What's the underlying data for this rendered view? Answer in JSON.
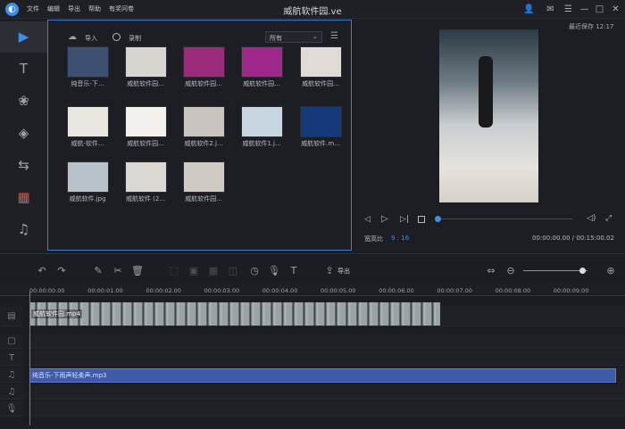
{
  "app": {
    "title": "威航软件园.ve",
    "menu": [
      "文件",
      "编辑",
      "导出",
      "帮助",
      "有奖问卷"
    ],
    "autosave": "最近保存 12:17"
  },
  "media_toolbar": {
    "import_label": "导入",
    "record_label": "录制",
    "filter_value": "所有"
  },
  "media_items": [
    {
      "label": "纯音乐-下..."
    },
    {
      "label": "威航软件园..."
    },
    {
      "label": "威航软件园..."
    },
    {
      "label": "威航软件园..."
    },
    {
      "label": "威航软件园..."
    },
    {
      "label": "威航-软件..."
    },
    {
      "label": "威航软件园..."
    },
    {
      "label": "威航软件2.j..."
    },
    {
      "label": "威航软件1.j..."
    },
    {
      "label": "威航软件.m..."
    },
    {
      "label": "威航软件.jpg"
    },
    {
      "label": "威航软件 (2..."
    },
    {
      "label": "威航软件园..."
    }
  ],
  "preview": {
    "aspect_label": "宽高比",
    "aspect_value": "9 : 16",
    "time": "00:00:00.00 / 00:15:00.02"
  },
  "timeline_toolbar": {
    "export_label": "导出"
  },
  "ruler": [
    "00:00:00.00",
    "00:00:01.00",
    "00:00:02.00",
    "00:00:03.00",
    "00:00:04.00",
    "00:00:05.00",
    "00:00:06.00",
    "00:00:07.00",
    "00:00:08.00",
    "00:00:09.00"
  ],
  "tracks": {
    "video_clip": "威航软件园.mp4",
    "audio_clip": "纯音乐-下雨声轻柔声.mp3"
  }
}
